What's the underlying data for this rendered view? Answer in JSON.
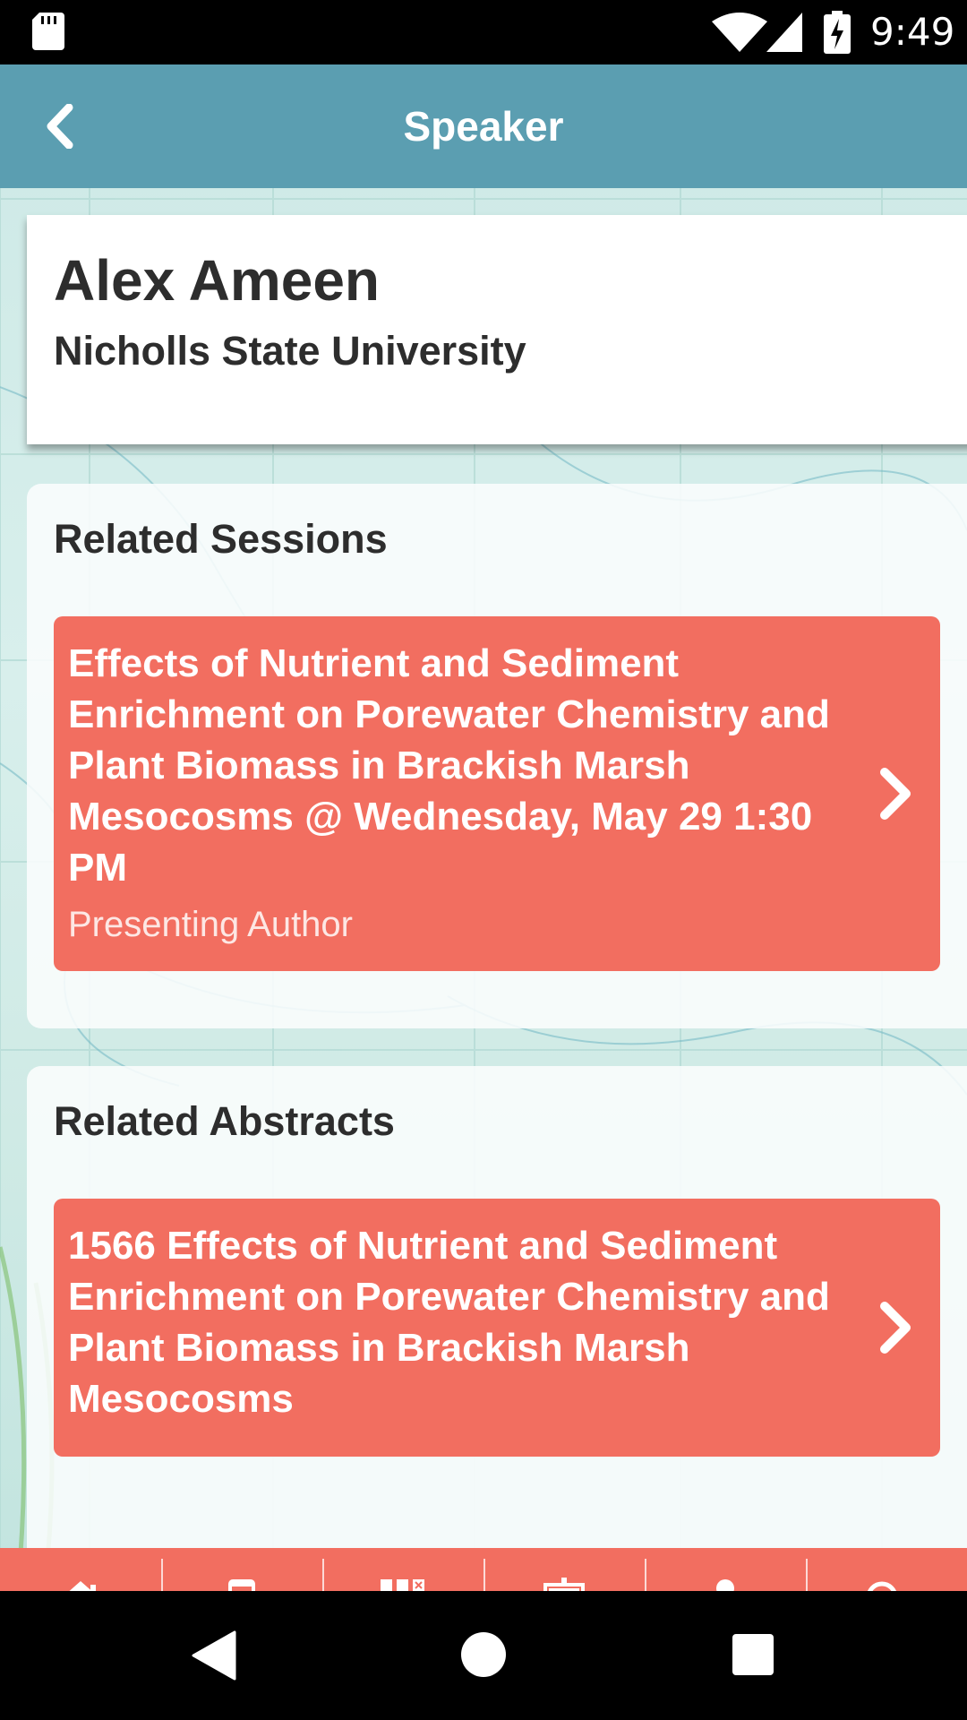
{
  "status_bar": {
    "time": "9:49"
  },
  "header": {
    "title": "Speaker"
  },
  "speaker": {
    "name": "Alex Ameen",
    "organization": "Nicholls State University"
  },
  "related_sessions": {
    "title": "Related Sessions",
    "items": [
      {
        "title": "Effects of Nutrient and Sediment Enrichment on Porewater Chemistry and Plant Biomass in Brackish Marsh Mesocosms @ Wednesday, May 29 1:30 PM",
        "role": "Presenting Author"
      }
    ]
  },
  "related_abstracts": {
    "title": "Related Abstracts",
    "items": [
      {
        "title": "1566 Effects of Nutrient and Sediment Enrichment on Porewater Chemistry and Plant Biomass in Brackish Marsh Mesocosms"
      }
    ]
  },
  "tab_bar": {
    "tabs": [
      {
        "icon": "home-icon"
      },
      {
        "icon": "phone-icon"
      },
      {
        "icon": "grid-icon"
      },
      {
        "icon": "presentation-icon"
      },
      {
        "icon": "speaker-icon"
      },
      {
        "icon": "search-icon"
      }
    ]
  },
  "colors": {
    "header": "#5b9eb1",
    "accent": "#f26e60",
    "background": "#cde9e6"
  }
}
